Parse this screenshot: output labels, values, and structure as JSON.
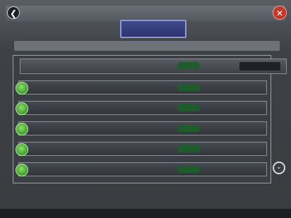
{
  "titlebar": {
    "left_text": "",
    "center_text": "",
    "back_icon": "back-arrow-icon",
    "close_icon": "close-icon"
  },
  "main_button": {
    "label": ""
  },
  "subheader": {
    "text": ""
  },
  "header_row": {
    "label": "",
    "status": "",
    "right_value": ""
  },
  "rows": [
    {
      "label": "",
      "status": "",
      "icon": "status-ok-icon"
    },
    {
      "label": "",
      "status": "",
      "icon": "status-ok-icon"
    },
    {
      "label": "",
      "status": "",
      "icon": "status-ok-icon"
    },
    {
      "label": "",
      "status": "",
      "icon": "status-ok-icon"
    },
    {
      "label": "",
      "status": "",
      "icon": "status-ok-icon"
    }
  ],
  "scroll_icon": "scroll-down-icon",
  "statusbar": {
    "left": "",
    "center": "",
    "right": ""
  },
  "colors": {
    "ok_green": "#3d9a2c",
    "status_pill": "#1f5c2c",
    "close_red": "#c0392b",
    "button_blue": "#2c3570"
  }
}
